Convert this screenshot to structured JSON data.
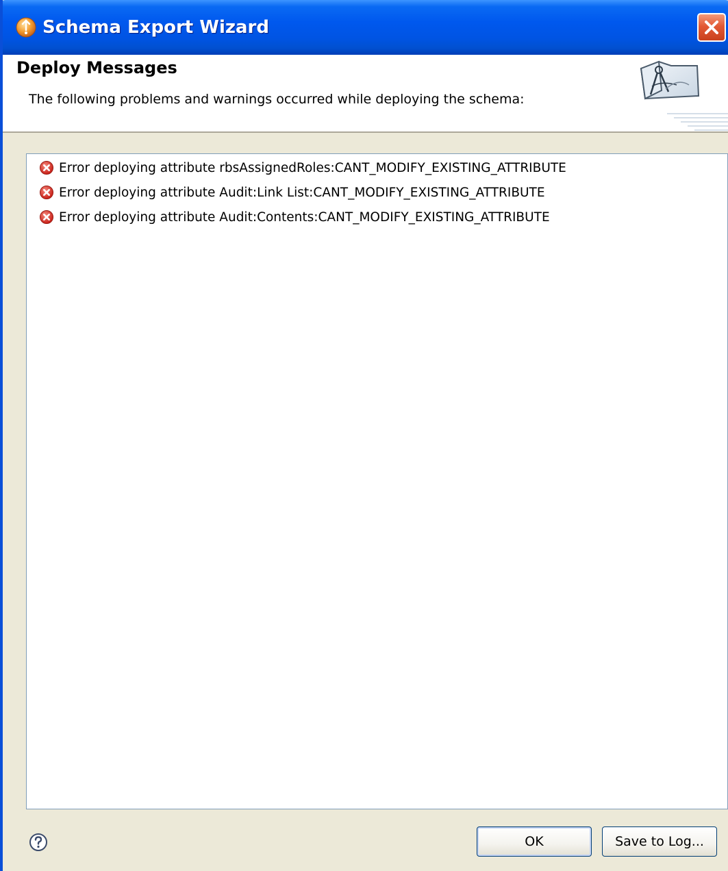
{
  "window": {
    "title": "Schema Export Wizard",
    "colors": {
      "titlebar": "#0054E3",
      "face": "#ECE9D8",
      "close": "#E35A35",
      "error": "#D8342C"
    }
  },
  "header": {
    "title": "Deploy Messages",
    "description": "The following problems and warnings occurred while deploying the schema:",
    "graphic_icon": "wizard-compass-banner-icon"
  },
  "messages": [
    {
      "severity": "error",
      "icon": "error-icon",
      "text": "Error deploying attribute rbsAssignedRoles:CANT_MODIFY_EXISTING_ATTRIBUTE"
    },
    {
      "severity": "error",
      "icon": "error-icon",
      "text": "Error deploying attribute Audit:Link List:CANT_MODIFY_EXISTING_ATTRIBUTE"
    },
    {
      "severity": "error",
      "icon": "error-icon",
      "text": "Error deploying attribute Audit:Contents:CANT_MODIFY_EXISTING_ATTRIBUTE"
    }
  ],
  "footer": {
    "help_icon": "help-icon",
    "ok_label": "OK",
    "save_log_label": "Save to Log..."
  }
}
